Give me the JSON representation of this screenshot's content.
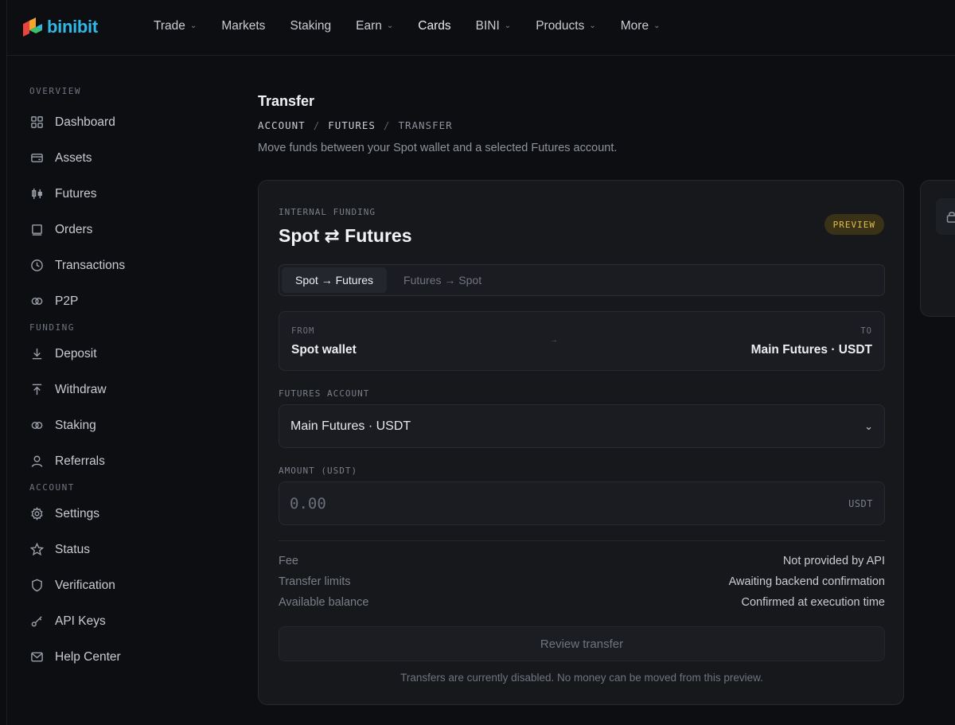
{
  "brand": {
    "name": "binibit"
  },
  "nav": [
    {
      "label": "Trade",
      "dropdown": true
    },
    {
      "label": "Markets",
      "dropdown": false
    },
    {
      "label": "Staking",
      "dropdown": false
    },
    {
      "label": "Earn",
      "dropdown": true
    },
    {
      "label": "Cards",
      "dropdown": false
    },
    {
      "label": "BINI",
      "dropdown": true
    },
    {
      "label": "Products",
      "dropdown": true
    },
    {
      "label": "More",
      "dropdown": true
    }
  ],
  "sidebar": {
    "overview_title": "OVERVIEW",
    "overview": [
      {
        "label": "Dashboard",
        "icon": "grid-icon"
      },
      {
        "label": "Assets",
        "icon": "wallet-icon"
      },
      {
        "label": "Futures",
        "icon": "candles-icon"
      },
      {
        "label": "Orders",
        "icon": "square-icon"
      },
      {
        "label": "Transactions",
        "icon": "clock-icon"
      },
      {
        "label": "P2P",
        "icon": "link-icon"
      }
    ],
    "funding_title": "FUNDING",
    "funding": [
      {
        "label": "Deposit",
        "icon": "download-icon"
      },
      {
        "label": "Withdraw",
        "icon": "upload-icon"
      },
      {
        "label": "Staking",
        "icon": "link-icon"
      },
      {
        "label": "Referrals",
        "icon": "user-icon"
      }
    ],
    "account_title": "ACCOUNT",
    "account": [
      {
        "label": "Settings",
        "icon": "gear-icon"
      },
      {
        "label": "Status",
        "icon": "star-icon"
      },
      {
        "label": "Verification",
        "icon": "shield-icon"
      },
      {
        "label": "API Keys",
        "icon": "key-icon"
      },
      {
        "label": "Help Center",
        "icon": "mail-icon"
      }
    ]
  },
  "page": {
    "title": "Transfer",
    "breadcrumb": [
      "ACCOUNT",
      "FUTURES",
      "TRANSFER"
    ],
    "subtitle": "Move funds between your Spot wallet and a selected Futures account."
  },
  "card": {
    "eyebrow": "INTERNAL FUNDING",
    "heading": "Spot ⇄ Futures",
    "badge": "PREVIEW",
    "badge_color": "#e1bd4c",
    "tabs": [
      {
        "label": "Spot → Futures",
        "active": true
      },
      {
        "label": "Futures → Spot",
        "active": false
      }
    ],
    "from_label": "FROM",
    "from_value": "Spot wallet",
    "to_label": "TO",
    "to_value": "Main Futures · USDT",
    "futures_account_label": "FUTURES ACCOUNT",
    "futures_account_value": "Main Futures · USDT",
    "amount_label": "AMOUNT (USDT)",
    "amount_placeholder": "0.00",
    "amount_unit": "USDT",
    "info": [
      {
        "key": "Fee",
        "value": "Not provided by API"
      },
      {
        "key": "Transfer limits",
        "value": "Awaiting backend confirmation"
      },
      {
        "key": "Available balance",
        "value": "Confirmed at execution time"
      }
    ],
    "review_button": "Review transfer",
    "footnote": "Transfers are currently disabled. No money can be moved from this preview."
  }
}
